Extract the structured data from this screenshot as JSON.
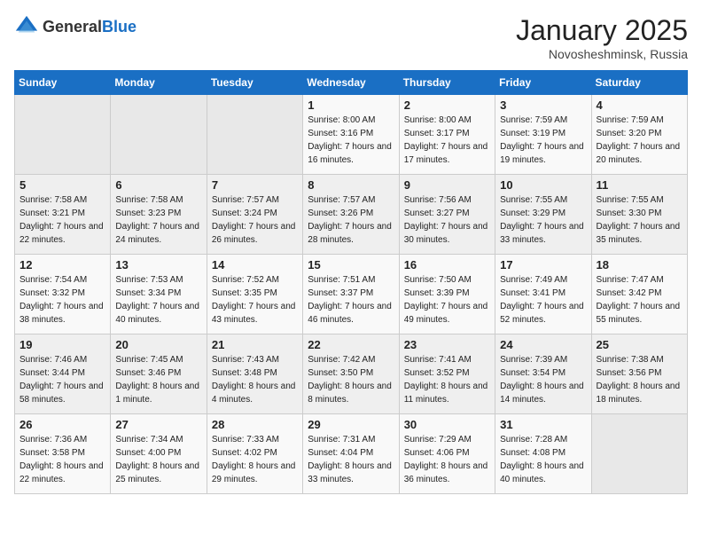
{
  "logo": {
    "general": "General",
    "blue": "Blue"
  },
  "title": "January 2025",
  "subtitle": "Novosheshminsk, Russia",
  "days_of_week": [
    "Sunday",
    "Monday",
    "Tuesday",
    "Wednesday",
    "Thursday",
    "Friday",
    "Saturday"
  ],
  "weeks": [
    [
      {
        "day": "",
        "sunrise": "",
        "sunset": "",
        "daylight": ""
      },
      {
        "day": "",
        "sunrise": "",
        "sunset": "",
        "daylight": ""
      },
      {
        "day": "",
        "sunrise": "",
        "sunset": "",
        "daylight": ""
      },
      {
        "day": "1",
        "sunrise": "Sunrise: 8:00 AM",
        "sunset": "Sunset: 3:16 PM",
        "daylight": "Daylight: 7 hours and 16 minutes."
      },
      {
        "day": "2",
        "sunrise": "Sunrise: 8:00 AM",
        "sunset": "Sunset: 3:17 PM",
        "daylight": "Daylight: 7 hours and 17 minutes."
      },
      {
        "day": "3",
        "sunrise": "Sunrise: 7:59 AM",
        "sunset": "Sunset: 3:19 PM",
        "daylight": "Daylight: 7 hours and 19 minutes."
      },
      {
        "day": "4",
        "sunrise": "Sunrise: 7:59 AM",
        "sunset": "Sunset: 3:20 PM",
        "daylight": "Daylight: 7 hours and 20 minutes."
      }
    ],
    [
      {
        "day": "5",
        "sunrise": "Sunrise: 7:58 AM",
        "sunset": "Sunset: 3:21 PM",
        "daylight": "Daylight: 7 hours and 22 minutes."
      },
      {
        "day": "6",
        "sunrise": "Sunrise: 7:58 AM",
        "sunset": "Sunset: 3:23 PM",
        "daylight": "Daylight: 7 hours and 24 minutes."
      },
      {
        "day": "7",
        "sunrise": "Sunrise: 7:57 AM",
        "sunset": "Sunset: 3:24 PM",
        "daylight": "Daylight: 7 hours and 26 minutes."
      },
      {
        "day": "8",
        "sunrise": "Sunrise: 7:57 AM",
        "sunset": "Sunset: 3:26 PM",
        "daylight": "Daylight: 7 hours and 28 minutes."
      },
      {
        "day": "9",
        "sunrise": "Sunrise: 7:56 AM",
        "sunset": "Sunset: 3:27 PM",
        "daylight": "Daylight: 7 hours and 30 minutes."
      },
      {
        "day": "10",
        "sunrise": "Sunrise: 7:55 AM",
        "sunset": "Sunset: 3:29 PM",
        "daylight": "Daylight: 7 hours and 33 minutes."
      },
      {
        "day": "11",
        "sunrise": "Sunrise: 7:55 AM",
        "sunset": "Sunset: 3:30 PM",
        "daylight": "Daylight: 7 hours and 35 minutes."
      }
    ],
    [
      {
        "day": "12",
        "sunrise": "Sunrise: 7:54 AM",
        "sunset": "Sunset: 3:32 PM",
        "daylight": "Daylight: 7 hours and 38 minutes."
      },
      {
        "day": "13",
        "sunrise": "Sunrise: 7:53 AM",
        "sunset": "Sunset: 3:34 PM",
        "daylight": "Daylight: 7 hours and 40 minutes."
      },
      {
        "day": "14",
        "sunrise": "Sunrise: 7:52 AM",
        "sunset": "Sunset: 3:35 PM",
        "daylight": "Daylight: 7 hours and 43 minutes."
      },
      {
        "day": "15",
        "sunrise": "Sunrise: 7:51 AM",
        "sunset": "Sunset: 3:37 PM",
        "daylight": "Daylight: 7 hours and 46 minutes."
      },
      {
        "day": "16",
        "sunrise": "Sunrise: 7:50 AM",
        "sunset": "Sunset: 3:39 PM",
        "daylight": "Daylight: 7 hours and 49 minutes."
      },
      {
        "day": "17",
        "sunrise": "Sunrise: 7:49 AM",
        "sunset": "Sunset: 3:41 PM",
        "daylight": "Daylight: 7 hours and 52 minutes."
      },
      {
        "day": "18",
        "sunrise": "Sunrise: 7:47 AM",
        "sunset": "Sunset: 3:42 PM",
        "daylight": "Daylight: 7 hours and 55 minutes."
      }
    ],
    [
      {
        "day": "19",
        "sunrise": "Sunrise: 7:46 AM",
        "sunset": "Sunset: 3:44 PM",
        "daylight": "Daylight: 7 hours and 58 minutes."
      },
      {
        "day": "20",
        "sunrise": "Sunrise: 7:45 AM",
        "sunset": "Sunset: 3:46 PM",
        "daylight": "Daylight: 8 hours and 1 minute."
      },
      {
        "day": "21",
        "sunrise": "Sunrise: 7:43 AM",
        "sunset": "Sunset: 3:48 PM",
        "daylight": "Daylight: 8 hours and 4 minutes."
      },
      {
        "day": "22",
        "sunrise": "Sunrise: 7:42 AM",
        "sunset": "Sunset: 3:50 PM",
        "daylight": "Daylight: 8 hours and 8 minutes."
      },
      {
        "day": "23",
        "sunrise": "Sunrise: 7:41 AM",
        "sunset": "Sunset: 3:52 PM",
        "daylight": "Daylight: 8 hours and 11 minutes."
      },
      {
        "day": "24",
        "sunrise": "Sunrise: 7:39 AM",
        "sunset": "Sunset: 3:54 PM",
        "daylight": "Daylight: 8 hours and 14 minutes."
      },
      {
        "day": "25",
        "sunrise": "Sunrise: 7:38 AM",
        "sunset": "Sunset: 3:56 PM",
        "daylight": "Daylight: 8 hours and 18 minutes."
      }
    ],
    [
      {
        "day": "26",
        "sunrise": "Sunrise: 7:36 AM",
        "sunset": "Sunset: 3:58 PM",
        "daylight": "Daylight: 8 hours and 22 minutes."
      },
      {
        "day": "27",
        "sunrise": "Sunrise: 7:34 AM",
        "sunset": "Sunset: 4:00 PM",
        "daylight": "Daylight: 8 hours and 25 minutes."
      },
      {
        "day": "28",
        "sunrise": "Sunrise: 7:33 AM",
        "sunset": "Sunset: 4:02 PM",
        "daylight": "Daylight: 8 hours and 29 minutes."
      },
      {
        "day": "29",
        "sunrise": "Sunrise: 7:31 AM",
        "sunset": "Sunset: 4:04 PM",
        "daylight": "Daylight: 8 hours and 33 minutes."
      },
      {
        "day": "30",
        "sunrise": "Sunrise: 7:29 AM",
        "sunset": "Sunset: 4:06 PM",
        "daylight": "Daylight: 8 hours and 36 minutes."
      },
      {
        "day": "31",
        "sunrise": "Sunrise: 7:28 AM",
        "sunset": "Sunset: 4:08 PM",
        "daylight": "Daylight: 8 hours and 40 minutes."
      },
      {
        "day": "",
        "sunrise": "",
        "sunset": "",
        "daylight": ""
      }
    ]
  ]
}
